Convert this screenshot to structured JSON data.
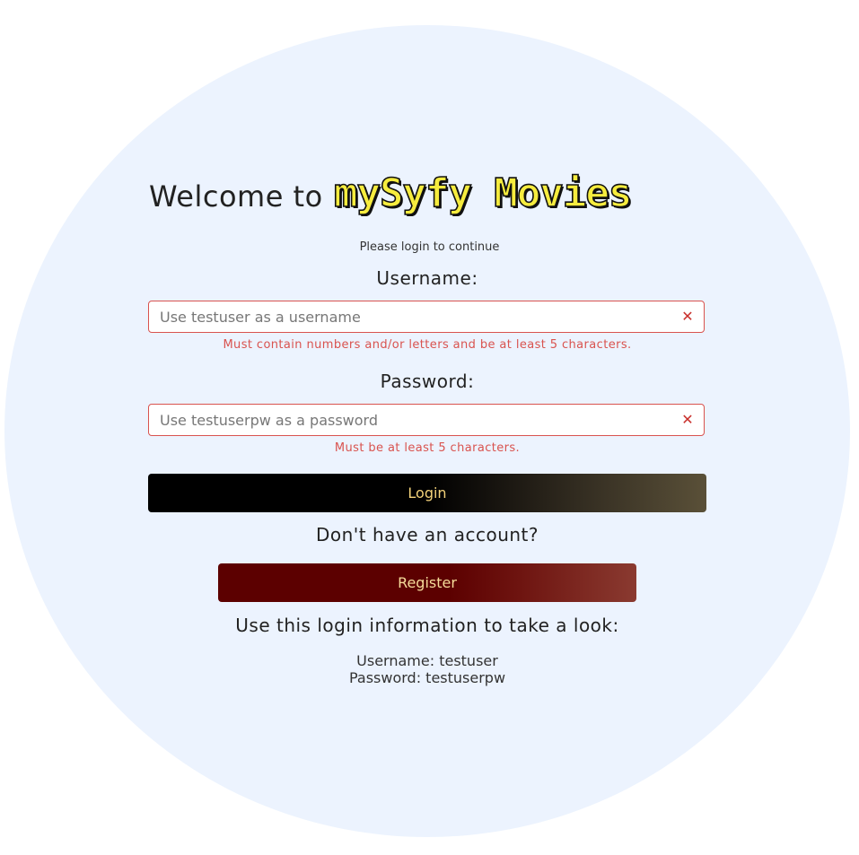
{
  "header": {
    "welcome_text": "Welcome to",
    "brand_logo_text": "mySyfy Movies",
    "subtitle": "Please login to continue"
  },
  "form": {
    "username": {
      "label": "Username:",
      "value": "",
      "placeholder": "Use testuser as a username",
      "error": "Must contain numbers and/or letters and be at least 5 characters."
    },
    "password": {
      "label": "Password:",
      "value": "",
      "placeholder": "Use testuserpw as a password",
      "error": "Must be at least 5 characters."
    },
    "clear_icon": "✕",
    "login_label": "Login"
  },
  "register": {
    "prompt": "Don't have an account?",
    "button_label": "Register"
  },
  "demo_info": {
    "heading": "Use this login information to take a look:",
    "username_line": "Username: testuser",
    "password_line": "Password: testuserpw"
  },
  "colors": {
    "background_circle": "#ecf3fe",
    "brand_yellow": "#f6ec3e",
    "error_red": "#d9534f",
    "login_gradient_end": "#5a5038",
    "register_red": "#5c0000"
  }
}
